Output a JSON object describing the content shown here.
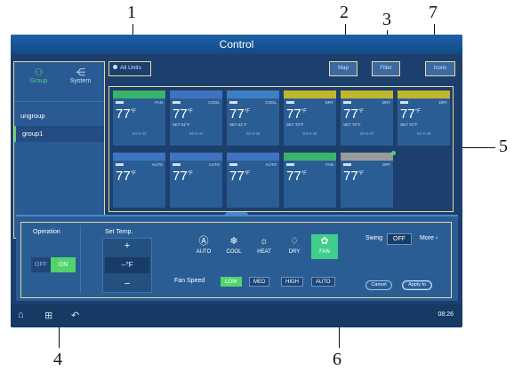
{
  "callouts": [
    "1",
    "2",
    "3",
    "7",
    "5",
    "4",
    "6"
  ],
  "title": "Control",
  "sidebar": {
    "tabs": [
      {
        "label": "Group",
        "icon": "group-icon"
      },
      {
        "label": "System",
        "icon": "system-icon"
      }
    ],
    "items": [
      {
        "label": "ungroup"
      },
      {
        "label": "group1"
      }
    ]
  },
  "toolbar": {
    "all_units": "All Units",
    "map": "Map",
    "filter": "Filter",
    "extra": "Icons"
  },
  "units": [
    {
      "band": "#38b56a",
      "mode": "FAN",
      "temp": "77",
      "unit": "°F",
      "set": "",
      "id": "S0-5-43"
    },
    {
      "band": "#3f73c0",
      "mode": "COOL",
      "temp": "77",
      "unit": "°F",
      "set": "SET 61°F",
      "id": "S0-5-44"
    },
    {
      "band": "#3d7fc2",
      "mode": "COOL",
      "temp": "77",
      "unit": "°F",
      "set": "SET 61°F",
      "id": "S0-5-45"
    },
    {
      "band": "#c1b629",
      "mode": "DRY",
      "temp": "77",
      "unit": "°F",
      "set": "SET 70°F",
      "id": "S0-5-46"
    },
    {
      "band": "#c1b629",
      "mode": "DRY",
      "temp": "77",
      "unit": "°F",
      "set": "SET 70°F",
      "id": "S0-5-47"
    },
    {
      "band": "#c1b629",
      "mode": "DRY",
      "temp": "77",
      "unit": "°F",
      "set": "SET 70°F",
      "id": "S0-5-48"
    },
    {
      "band": "#3f73c0",
      "mode": "AUTO",
      "temp": "77",
      "unit": "°F",
      "set": "",
      "id": ""
    },
    {
      "band": "#3f73c0",
      "mode": "AUTO",
      "temp": "77",
      "unit": "°F",
      "set": "",
      "id": ""
    },
    {
      "band": "#3f73c0",
      "mode": "AUTO",
      "temp": "77",
      "unit": "°F",
      "set": "",
      "id": ""
    },
    {
      "band": "#38b56a",
      "mode": "FAN",
      "temp": "77",
      "unit": "°F",
      "set": "",
      "id": ""
    },
    {
      "band": "#9a9a9a",
      "mode": "OFF",
      "temp": "77",
      "unit": "°F",
      "set": "",
      "id": ""
    }
  ],
  "control": {
    "operation_label": "Operation",
    "off_label": "OFF",
    "on_label": "ON",
    "set_temp_label": "Set Temp.",
    "plus": "+",
    "minus": "−",
    "temp_value": "--°F",
    "modes": [
      {
        "label": "AUTO",
        "icon": "auto-icon",
        "glyph": "Ⓐ"
      },
      {
        "label": "COOL",
        "icon": "snowflake-icon",
        "glyph": "❄"
      },
      {
        "label": "HEAT",
        "icon": "sun-icon",
        "glyph": "☼"
      },
      {
        "label": "DRY",
        "icon": "droplet-icon",
        "glyph": "♢"
      },
      {
        "label": "FAN",
        "icon": "fan-icon",
        "glyph": "✿"
      }
    ],
    "active_mode": "FAN",
    "fan_speed_label": "Fan Speed",
    "fan_speeds": [
      "LOW",
      "MED",
      "HIGH",
      "AUTO"
    ],
    "active_fan_speed": "LOW",
    "swing_label": "Swing",
    "swing_value": "OFF",
    "more_label": "More",
    "cancel_label": "Cancel",
    "apply_label": "Apply to"
  },
  "bottom_bar": {
    "clock": "08:26"
  },
  "colors": {
    "accent": "#52d36b",
    "frame": "#e7d8a0",
    "background": "#1d3f6e"
  }
}
